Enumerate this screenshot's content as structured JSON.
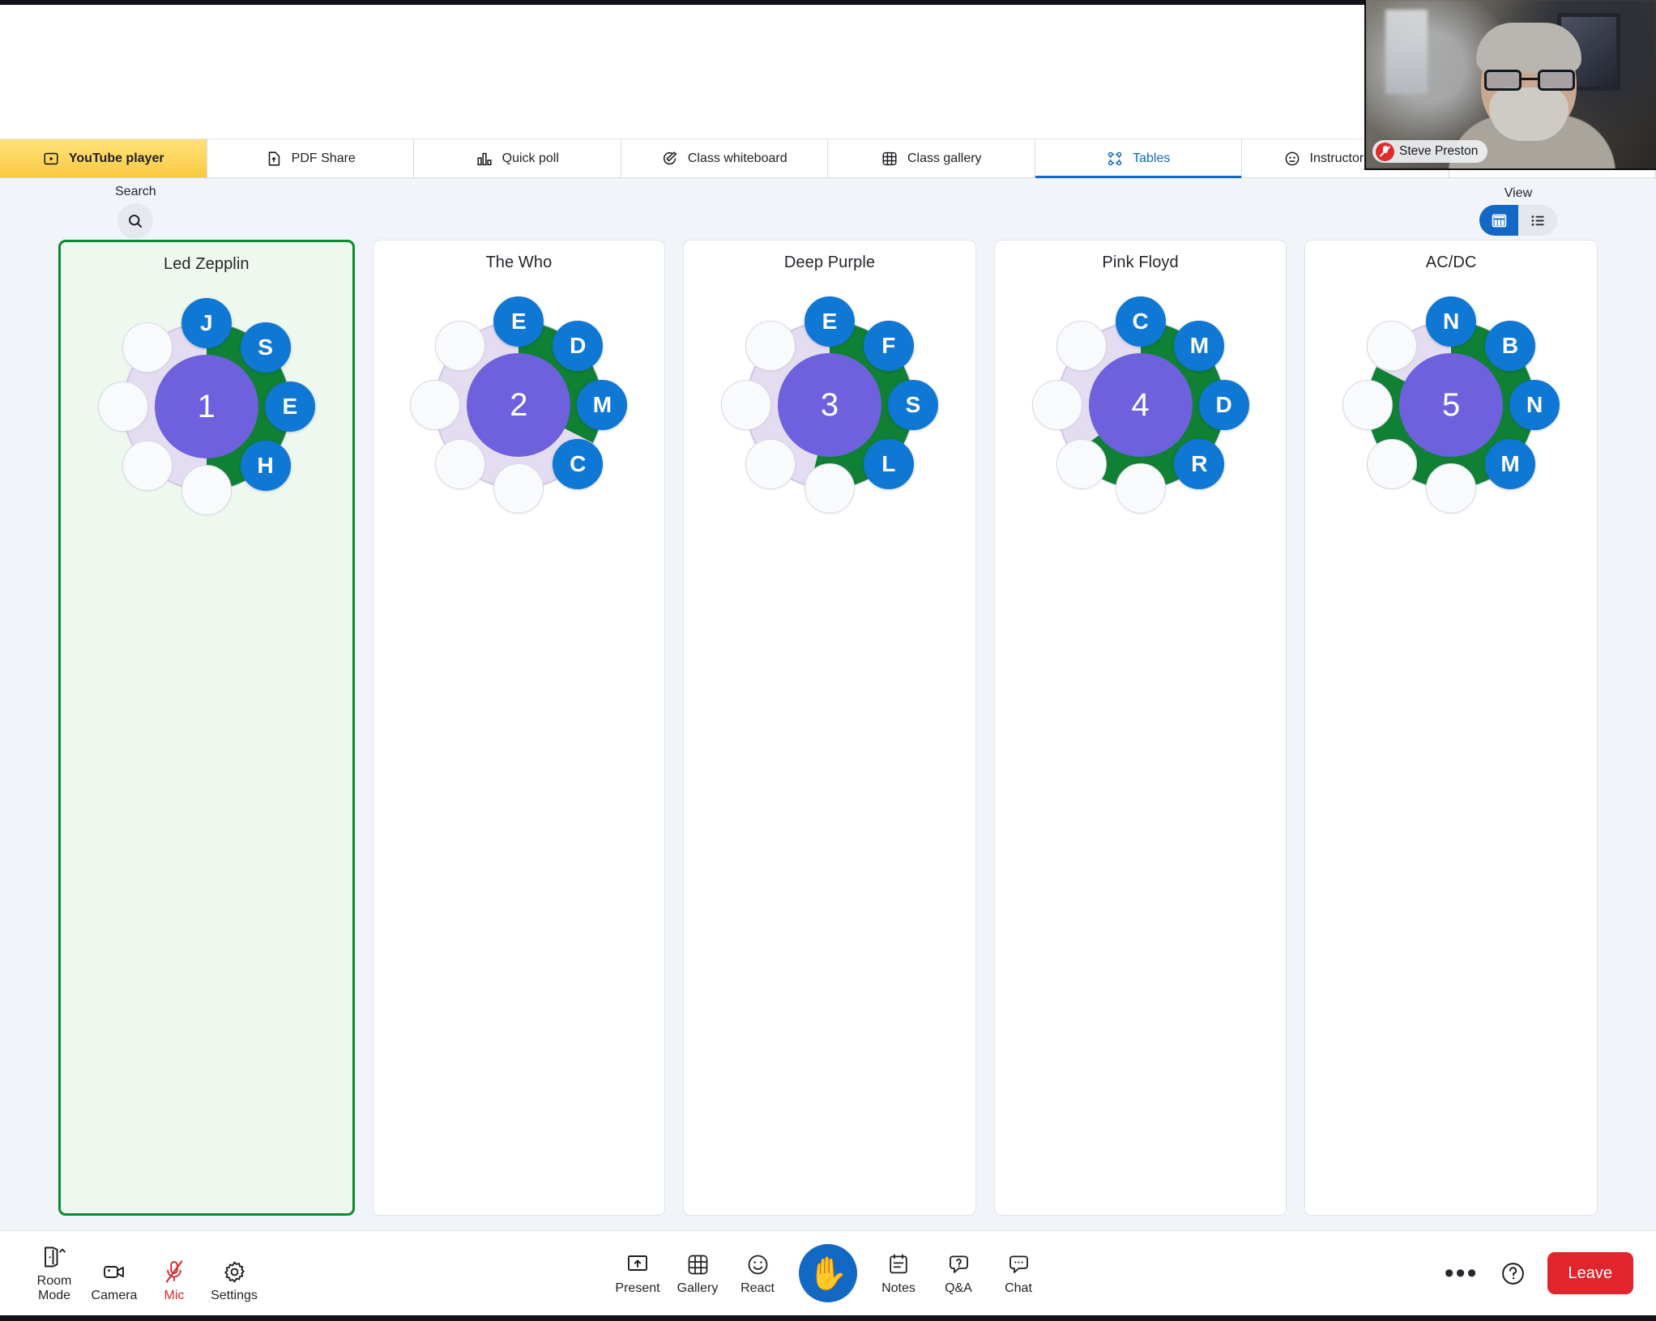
{
  "tabs": [
    {
      "label": "YouTube player",
      "icon": "youtube-player-icon",
      "state": "highlight"
    },
    {
      "label": "PDF Share",
      "icon": "pdf-share-icon",
      "state": "normal"
    },
    {
      "label": "Quick poll",
      "icon": "quick-poll-icon",
      "state": "normal"
    },
    {
      "label": "Class whiteboard",
      "icon": "whiteboard-icon",
      "state": "normal"
    },
    {
      "label": "Class gallery",
      "icon": "class-gallery-icon",
      "state": "normal"
    },
    {
      "label": "Tables",
      "icon": "tables-icon",
      "state": "active"
    },
    {
      "label": "Instructor's video",
      "icon": "instructor-video-icon",
      "state": "normal"
    },
    {
      "label": "",
      "icon": "",
      "state": "empty"
    }
  ],
  "self_view": {
    "name": "Steve Preston",
    "muted": true,
    "mic_icon": "mic-off-icon"
  },
  "toolbar": {
    "search_label": "Search",
    "search_icon": "search-icon",
    "view_label": "View",
    "view_modes": [
      {
        "name": "columns",
        "icon": "columns-view-icon",
        "active": true
      },
      {
        "name": "list",
        "icon": "list-view-icon",
        "active": false
      }
    ]
  },
  "colors": {
    "accent_blue": "#1268c3",
    "seat_blue": "#0f77d4",
    "table_center_purple": "#6f60dd",
    "ring_lavender": "#e4ddf2",
    "progress_green": "#0f8034",
    "selected_border": "#0a8a33",
    "selected_bg": "#eef8ef",
    "tab_highlight_yellow": "#ffd75e",
    "leave_red": "#e0262c",
    "mic_muted_red": "#d22b2b"
  },
  "tables": [
    {
      "title": "Led Zepplin",
      "number": "1",
      "selected": true,
      "seat_count": 8,
      "filled_seats": 4,
      "progress_seats": 4,
      "seats": [
        "J",
        "S",
        "E",
        "H",
        "",
        "",
        "",
        ""
      ]
    },
    {
      "title": "The Who",
      "number": "2",
      "selected": false,
      "seat_count": 8,
      "filled_seats": 4,
      "progress_seats": 2.6,
      "seats": [
        "E",
        "D",
        "M",
        "C",
        "",
        "",
        "",
        ""
      ]
    },
    {
      "title": "Deep Purple",
      "number": "3",
      "selected": false,
      "seat_count": 8,
      "filled_seats": 4,
      "progress_seats": 4.3,
      "seats": [
        "E",
        "F",
        "S",
        "L",
        "",
        "",
        "",
        ""
      ]
    },
    {
      "title": "Pink Floyd",
      "number": "4",
      "selected": false,
      "seat_count": 8,
      "filled_seats": 4,
      "progress_seats": 5.2,
      "seats": [
        "C",
        "M",
        "D",
        "R",
        "",
        "",
        "",
        ""
      ]
    },
    {
      "title": "AC/DC",
      "number": "5",
      "selected": false,
      "seat_count": 8,
      "filled_seats": 4,
      "progress_seats": 6.6,
      "seats": [
        "N",
        "B",
        "N",
        "M",
        "",
        "",
        "",
        ""
      ]
    }
  ],
  "footer": {
    "left": [
      {
        "label": "Room Mode",
        "icon": "door-icon",
        "state": "normal",
        "chevron": true
      },
      {
        "label": "Camera",
        "icon": "camera-icon",
        "state": "normal",
        "chevron": false
      },
      {
        "label": "Mic",
        "icon": "mic-off-icon",
        "state": "muted",
        "chevron": false
      },
      {
        "label": "Settings",
        "icon": "gear-icon",
        "state": "normal",
        "chevron": false
      }
    ],
    "center_left": [
      {
        "label": "Present",
        "icon": "present-icon"
      },
      {
        "label": "Gallery",
        "icon": "gallery-icon"
      },
      {
        "label": "React",
        "icon": "react-smiley-icon"
      }
    ],
    "raise_hand": {
      "name": "raise-hand-button",
      "icon": "raised-hand-icon",
      "glyph": "✋",
      "active": true
    },
    "center_right": [
      {
        "label": "Notes",
        "icon": "notes-icon"
      },
      {
        "label": "Q&A",
        "icon": "qa-icon"
      },
      {
        "label": "Chat",
        "icon": "chat-icon"
      }
    ],
    "more_label": "•••",
    "more_icon": "more-options-icon",
    "help_icon": "help-icon",
    "leave_label": "Leave"
  }
}
